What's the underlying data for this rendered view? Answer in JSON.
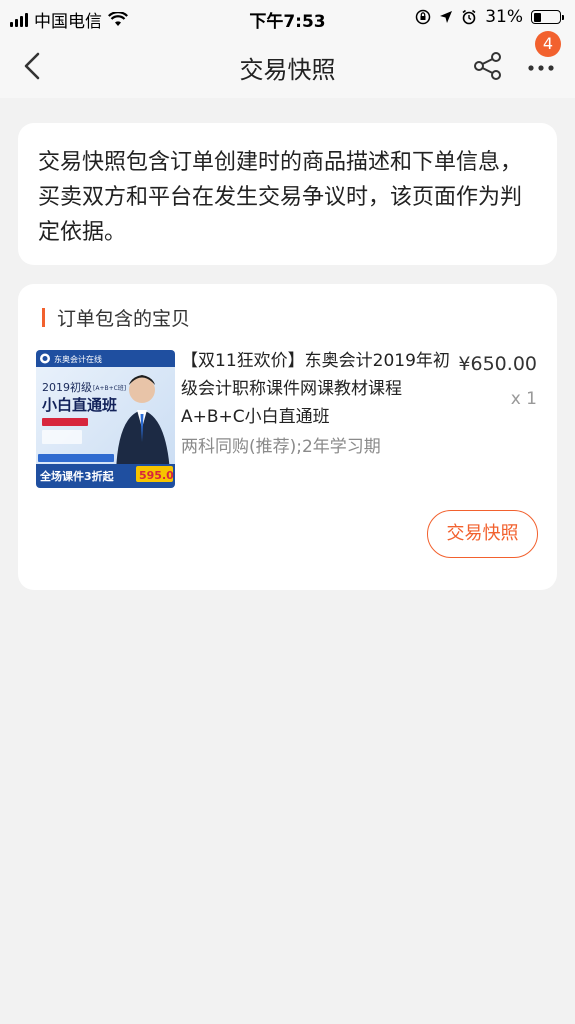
{
  "status_bar": {
    "carrier": "中国电信",
    "time": "下午7:53",
    "battery": "31%"
  },
  "nav": {
    "title": "交易快照",
    "badge_count": "4"
  },
  "description": {
    "text": "交易快照包含订单创建时的商品描述和下单信息，买卖双方和平台在发生交易争议时，该页面作为判定依据。"
  },
  "order": {
    "section_title": "订单包含的宝贝",
    "item": {
      "title": "【双11狂欢价】东奥会计2019年初级会计职称课件网课教材课程A+B+C小白直通班",
      "spec": "两科同购(推荐);2年学习期",
      "price": "¥650.00",
      "quantity": "x 1",
      "image": {
        "brand": "东奥会计在线",
        "heading_small": "2019初级",
        "heading_tag": "[A+B+C班]",
        "heading_big": "小白直通班",
        "promo": "全场课件3折起",
        "price": "595.0"
      }
    },
    "snapshot_button": "交易快照"
  },
  "colors": {
    "accent": "#f2612e",
    "background": "#f2f2f2",
    "card": "#ffffff"
  }
}
